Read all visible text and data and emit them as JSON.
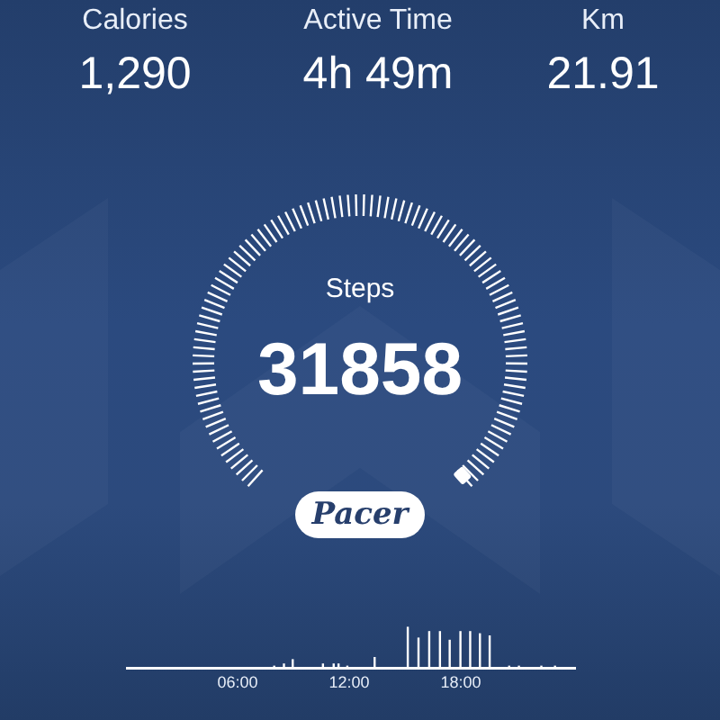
{
  "stats": [
    {
      "label": "Calories",
      "value": "1,290"
    },
    {
      "label": "Active Time",
      "value": "4h 49m"
    },
    {
      "label": "Km",
      "value": "21.91"
    }
  ],
  "gauge": {
    "label": "Steps",
    "value": "31858"
  },
  "logo": "Pacer",
  "activity_chart": {
    "time_labels": [
      "06:00",
      "12:00",
      "18:00"
    ]
  }
}
